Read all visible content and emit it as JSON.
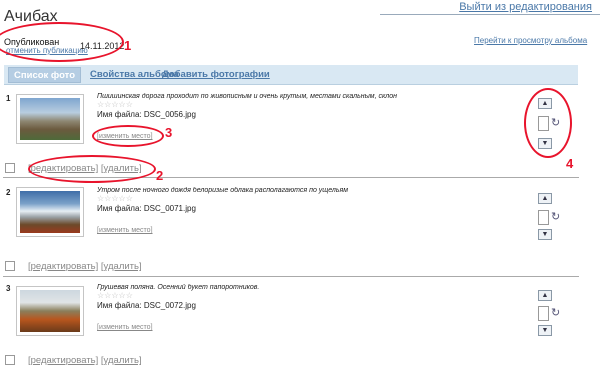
{
  "page": {
    "title": "Ачибах",
    "exit_link": "Выйти из редактирования",
    "status": "Опубликован",
    "unpublish_link": "отменить публикацию",
    "pub_date": "14.11.2012",
    "goto_album_link": "Перейти к просмотру альбома"
  },
  "tabs": [
    {
      "label": "Список фото",
      "active": true
    },
    {
      "label": "Свойства альбома",
      "active": false
    },
    {
      "label": "Добавить фотографии",
      "active": false
    }
  ],
  "photos": [
    {
      "num": "1",
      "description": "Пшишинская дорога проходит по живописным и очень крутым, местами скальным, склонам правого берега Бзыби",
      "stars": "☆☆☆☆☆",
      "filename": "Имя файла: DSC_0056.jpg",
      "change_place": "[изменить место]",
      "edit": "[редактировать]",
      "delete": "[удалить]"
    },
    {
      "num": "2",
      "description": "Утром после ночного дождя белоризые облака располагаются по ущельям",
      "stars": "☆☆☆☆☆",
      "filename": "Имя файла: DSC_0071.jpg",
      "change_place": "[изменить место]",
      "edit": "[редактировать]",
      "delete": "[удалить]"
    },
    {
      "num": "3",
      "description": "Грушевая поляна. Осенний букет папоротников.",
      "stars": "☆☆☆☆☆",
      "filename": "Имя файла: DSC_0072.jpg",
      "change_place": "[изменить место]",
      "edit": "[редактировать]",
      "delete": "[удалить]"
    }
  ],
  "annotations": [
    "1",
    "2",
    "3",
    "4"
  ],
  "icons": {
    "move_up": "move-up-icon",
    "move_down": "move-down-icon",
    "rotate": "rotate-icon"
  }
}
